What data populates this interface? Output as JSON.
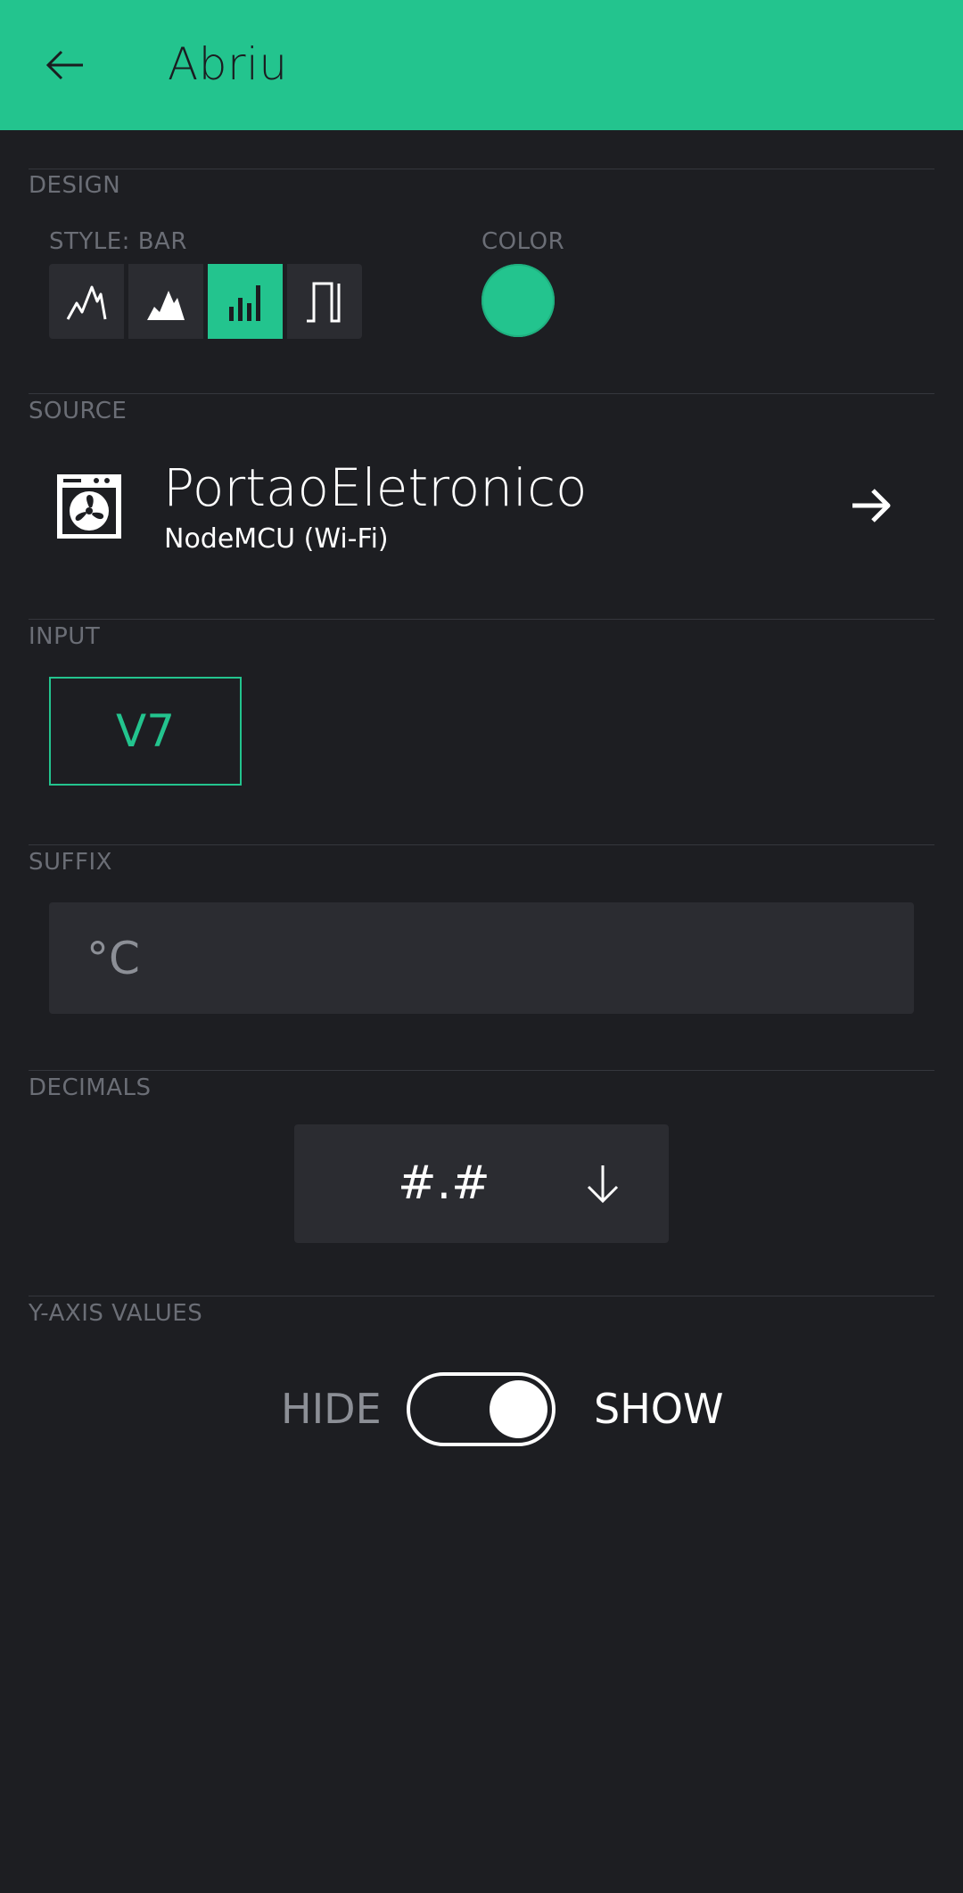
{
  "header": {
    "title": "Abriu",
    "back_icon": "arrow-left-icon"
  },
  "design": {
    "section_label": "DESIGN",
    "style_label": "STYLE: BAR",
    "color_label": "COLOR",
    "styles": [
      {
        "name": "line",
        "icon": "line-chart-icon",
        "active": false
      },
      {
        "name": "area",
        "icon": "area-chart-icon",
        "active": false
      },
      {
        "name": "bar",
        "icon": "bar-chart-icon",
        "active": true
      },
      {
        "name": "binary",
        "icon": "binary-chart-icon",
        "active": false
      }
    ],
    "color": "#23c48e"
  },
  "source": {
    "section_label": "SOURCE",
    "name": "PortaoEletronico",
    "device": "NodeMCU (Wi-Fi)",
    "icon": "fan-device-icon"
  },
  "input": {
    "section_label": "INPUT",
    "pin": "V7"
  },
  "suffix": {
    "section_label": "SUFFIX",
    "value": "°C"
  },
  "decimals": {
    "section_label": "DECIMALS",
    "value": "#.#"
  },
  "y_axis": {
    "section_label": "Y-AXIS VALUES",
    "off_label": "HIDE",
    "on_label": "SHOW",
    "state": "SHOW"
  },
  "colors": {
    "accent": "#23c48e",
    "background": "#1d1e22",
    "control": "#2b2c31"
  }
}
